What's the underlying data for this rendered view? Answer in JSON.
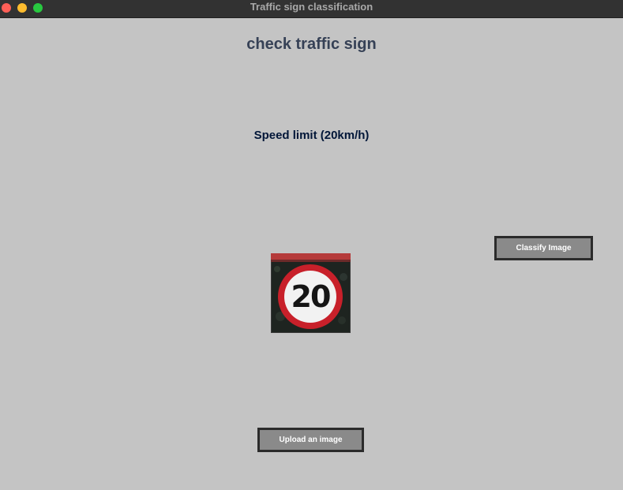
{
  "window": {
    "title": "Traffic sign classification"
  },
  "main": {
    "heading": "check traffic sign",
    "result_label": "Speed limit (20km/h)",
    "classify_button": "Classify Image",
    "upload_button": "Upload an image"
  },
  "image": {
    "sign_number": "20"
  },
  "colors": {
    "background": "#c4c4c4",
    "heading": "#364156",
    "result": "#011638",
    "button_bg": "#8a8a8a"
  }
}
